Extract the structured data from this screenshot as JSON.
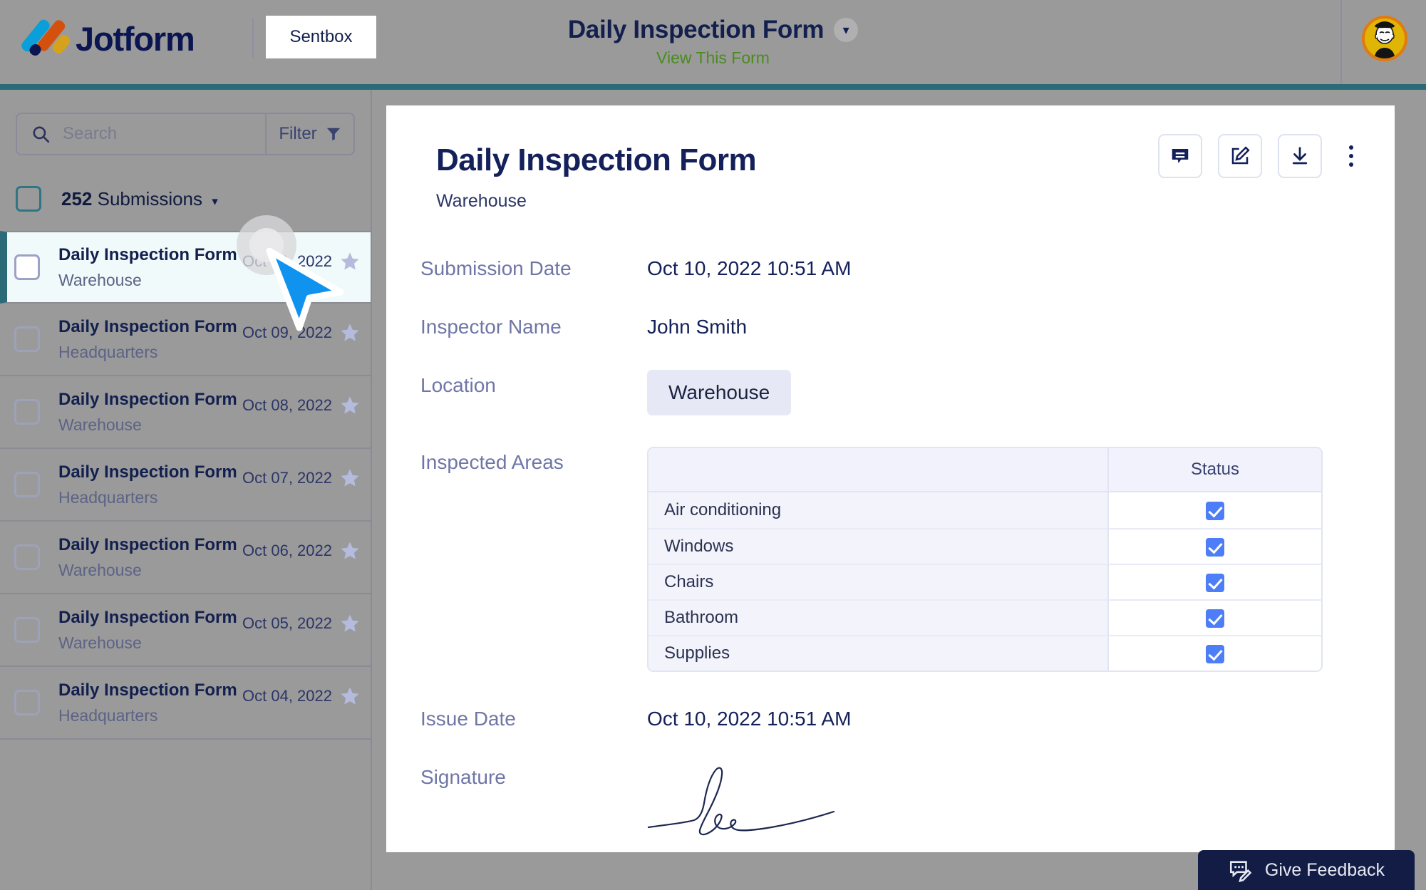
{
  "header": {
    "brand_name": "Jotform",
    "brand_logo_icon": "jotform-logo-icon",
    "sentbox_label": "Sentbox",
    "form_title": "Daily Inspection Form",
    "form_title_caret_icon": "chevron-down-icon",
    "view_form_link": "View This Form",
    "avatar_icon": "user-avatar",
    "accent_teal": "#2b6a77",
    "link_green": "#4b8b1f",
    "navy": "#13204e"
  },
  "sidebar": {
    "search": {
      "value": "",
      "placeholder": "Search",
      "icon": "search-icon"
    },
    "filter": {
      "label": "Filter",
      "icon": "funnel-icon"
    },
    "summary": {
      "count": "252",
      "label": "Submissions",
      "caret_icon": "chevron-down-icon"
    },
    "rows": [
      {
        "title": "Daily Inspection Form",
        "location": "Warehouse",
        "date": "Oct 10, 2022",
        "selected": true
      },
      {
        "title": "Daily Inspection Form",
        "location": "Headquarters",
        "date": "Oct 09, 2022",
        "selected": false
      },
      {
        "title": "Daily Inspection Form",
        "location": "Warehouse",
        "date": "Oct 08, 2022",
        "selected": false
      },
      {
        "title": "Daily Inspection Form",
        "location": "Headquarters",
        "date": "Oct 07, 2022",
        "selected": false
      },
      {
        "title": "Daily Inspection Form",
        "location": "Warehouse",
        "date": "Oct 06, 2022",
        "selected": false
      },
      {
        "title": "Daily Inspection Form",
        "location": "Warehouse",
        "date": "Oct 05, 2022",
        "selected": false
      },
      {
        "title": "Daily Inspection Form",
        "location": "Headquarters",
        "date": "Oct 04, 2022",
        "selected": false
      }
    ],
    "star_icon": "star-icon"
  },
  "submission": {
    "title": "Daily Inspection Form",
    "subtitle": "Warehouse",
    "tools": [
      {
        "name": "notes-button",
        "icon": "speech-bubble-icon"
      },
      {
        "name": "edit-button",
        "icon": "pencil-square-icon"
      },
      {
        "name": "download-button",
        "icon": "download-icon"
      },
      {
        "name": "more-button",
        "icon": "kebab-menu-icon"
      }
    ],
    "fields": {
      "submission_date": {
        "label": "Submission Date",
        "value": "Oct 10, 2022 10:51 AM"
      },
      "inspector_name": {
        "label": "Inspector Name",
        "value": "John Smith"
      },
      "location": {
        "label": "Location",
        "value": "Warehouse"
      },
      "inspected_areas": {
        "label": "Inspected Areas"
      },
      "issue_date": {
        "label": "Issue Date",
        "value": "Oct 10, 2022 10:51 AM"
      },
      "signature": {
        "label": "Signature",
        "value": "lee",
        "icon": "signature-icon"
      }
    },
    "table": {
      "columns": [
        "",
        "Status"
      ],
      "rows": [
        {
          "area": "Air conditioning",
          "status": "checked"
        },
        {
          "area": "Windows",
          "status": "checked"
        },
        {
          "area": "Chairs",
          "status": "checked"
        },
        {
          "area": "Bathroom",
          "status": "checked"
        },
        {
          "area": "Supplies",
          "status": "checked"
        }
      ],
      "checkbox_color": "#4d7ef7"
    }
  },
  "feedback": {
    "label": "Give Feedback",
    "icon": "feedback-icon"
  },
  "cursor": {
    "icon": "mouse-pointer-icon",
    "click_ripple": true
  }
}
